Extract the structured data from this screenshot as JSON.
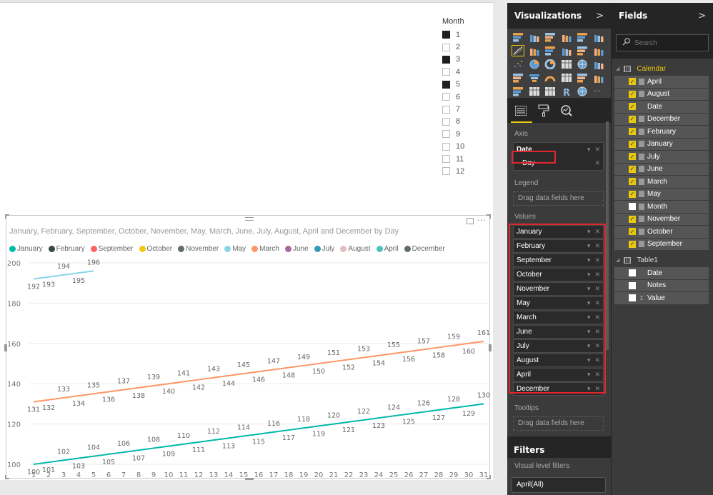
{
  "slicer": {
    "title": "Month",
    "items": [
      {
        "label": "1",
        "checked": true
      },
      {
        "label": "2",
        "checked": false
      },
      {
        "label": "3",
        "checked": true
      },
      {
        "label": "4",
        "checked": false
      },
      {
        "label": "5",
        "checked": true
      },
      {
        "label": "6",
        "checked": false
      },
      {
        "label": "7",
        "checked": false
      },
      {
        "label": "8",
        "checked": false
      },
      {
        "label": "9",
        "checked": false
      },
      {
        "label": "10",
        "checked": false
      },
      {
        "label": "11",
        "checked": false
      },
      {
        "label": "12",
        "checked": false
      }
    ]
  },
  "visual": {
    "more_label": "···"
  },
  "chart_data": {
    "type": "line",
    "title": "January, February, September, October, November, May, March, June, July, August, April and December by Day",
    "xlabel": "",
    "ylabel": "",
    "x": [
      1,
      2,
      3,
      4,
      5,
      6,
      7,
      8,
      9,
      10,
      11,
      12,
      13,
      14,
      15,
      16,
      17,
      18,
      19,
      20,
      21,
      22,
      23,
      24,
      25,
      26,
      27,
      28,
      29,
      30,
      31
    ],
    "ylim": [
      100,
      200
    ],
    "yticks": [
      100,
      120,
      140,
      160,
      180,
      200
    ],
    "grid": true,
    "legend_position": "top-left",
    "legend": [
      {
        "name": "January",
        "color": "#01b8aa"
      },
      {
        "name": "February",
        "color": "#374649"
      },
      {
        "name": "September",
        "color": "#fd625e"
      },
      {
        "name": "October",
        "color": "#f2c80f"
      },
      {
        "name": "November",
        "color": "#5f6b6d"
      },
      {
        "name": "May",
        "color": "#8ad4eb"
      },
      {
        "name": "March",
        "color": "#fe9666"
      },
      {
        "name": "June",
        "color": "#a66999"
      },
      {
        "name": "July",
        "color": "#3599b8"
      },
      {
        "name": "August",
        "color": "#dfbfbf"
      },
      {
        "name": "April",
        "color": "#4ac5bb"
      },
      {
        "name": "December",
        "color": "#5f6b6d"
      }
    ],
    "series": [
      {
        "name": "May",
        "color": "#8ad4eb",
        "x": [
          1,
          2,
          3,
          4,
          5
        ],
        "values": [
          192,
          193,
          194,
          195,
          196
        ]
      },
      {
        "name": "March",
        "color": "#fe9666",
        "x": [
          1,
          2,
          3,
          4,
          5,
          6,
          7,
          8,
          9,
          10,
          11,
          12,
          13,
          14,
          15,
          16,
          17,
          18,
          19,
          20,
          21,
          22,
          23,
          24,
          25,
          26,
          27,
          28,
          29,
          30,
          31
        ],
        "values": [
          131,
          132,
          133,
          134,
          135,
          136,
          137,
          138,
          139,
          140,
          141,
          142,
          143,
          144,
          145,
          146,
          147,
          148,
          149,
          150,
          151,
          152,
          153,
          154,
          155,
          156,
          157,
          158,
          159,
          160,
          161
        ]
      },
      {
        "name": "January",
        "color": "#01b8aa",
        "x": [
          1,
          2,
          3,
          4,
          5,
          6,
          7,
          8,
          9,
          10,
          11,
          12,
          13,
          14,
          15,
          16,
          17,
          18,
          19,
          20,
          21,
          22,
          23,
          24,
          25,
          26,
          27,
          28,
          29,
          30,
          31
        ],
        "values": [
          100,
          101,
          102,
          103,
          104,
          105,
          106,
          107,
          108,
          109,
          110,
          111,
          112,
          113,
          114,
          115,
          116,
          117,
          118,
          119,
          120,
          121,
          122,
          123,
          124,
          125,
          126,
          127,
          128,
          129,
          130
        ]
      }
    ]
  },
  "viz_pane": {
    "title": "Visualizations",
    "chevron": ">",
    "axis_label": "Axis",
    "axis_fields": [
      {
        "label": "Date"
      },
      {
        "label": "Day"
      }
    ],
    "legend_label": "Legend",
    "legend_drop": "Drag data fields here",
    "values_label": "Values",
    "values": [
      "January",
      "February",
      "September",
      "October",
      "November",
      "May",
      "March",
      "June",
      "July",
      "August",
      "April",
      "December"
    ],
    "tooltips_label": "Tooltips",
    "tooltips_drop": "Drag data fields here",
    "filters_title": "Filters",
    "visual_filters_label": "Visual level filters",
    "filter_value": "April(All)",
    "accent": "#e8c70e",
    "highlight": "#e3262e"
  },
  "fields_pane": {
    "title": "Fields",
    "chevron": ">",
    "search_placeholder": "Search",
    "tables": [
      {
        "name": "Calendar",
        "fields": [
          {
            "name": "April",
            "checked": true,
            "type": "calc"
          },
          {
            "name": "August",
            "checked": true,
            "type": "calc"
          },
          {
            "name": "Date",
            "checked": true,
            "type": "none"
          },
          {
            "name": "December",
            "checked": true,
            "type": "calc"
          },
          {
            "name": "February",
            "checked": true,
            "type": "calc"
          },
          {
            "name": "January",
            "checked": true,
            "type": "calc"
          },
          {
            "name": "July",
            "checked": true,
            "type": "calc"
          },
          {
            "name": "June",
            "checked": true,
            "type": "calc"
          },
          {
            "name": "March",
            "checked": true,
            "type": "calc"
          },
          {
            "name": "May",
            "checked": true,
            "type": "calc"
          },
          {
            "name": "Month",
            "checked": false,
            "type": "hierarchy"
          },
          {
            "name": "November",
            "checked": true,
            "type": "calc"
          },
          {
            "name": "October",
            "checked": true,
            "type": "calc"
          },
          {
            "name": "September",
            "checked": true,
            "type": "calc"
          }
        ]
      },
      {
        "name": "Table1",
        "fields": [
          {
            "name": "Date",
            "checked": false,
            "type": "none"
          },
          {
            "name": "Notes",
            "checked": false,
            "type": "none"
          },
          {
            "name": "Value",
            "checked": false,
            "type": "sum"
          }
        ]
      }
    ]
  }
}
